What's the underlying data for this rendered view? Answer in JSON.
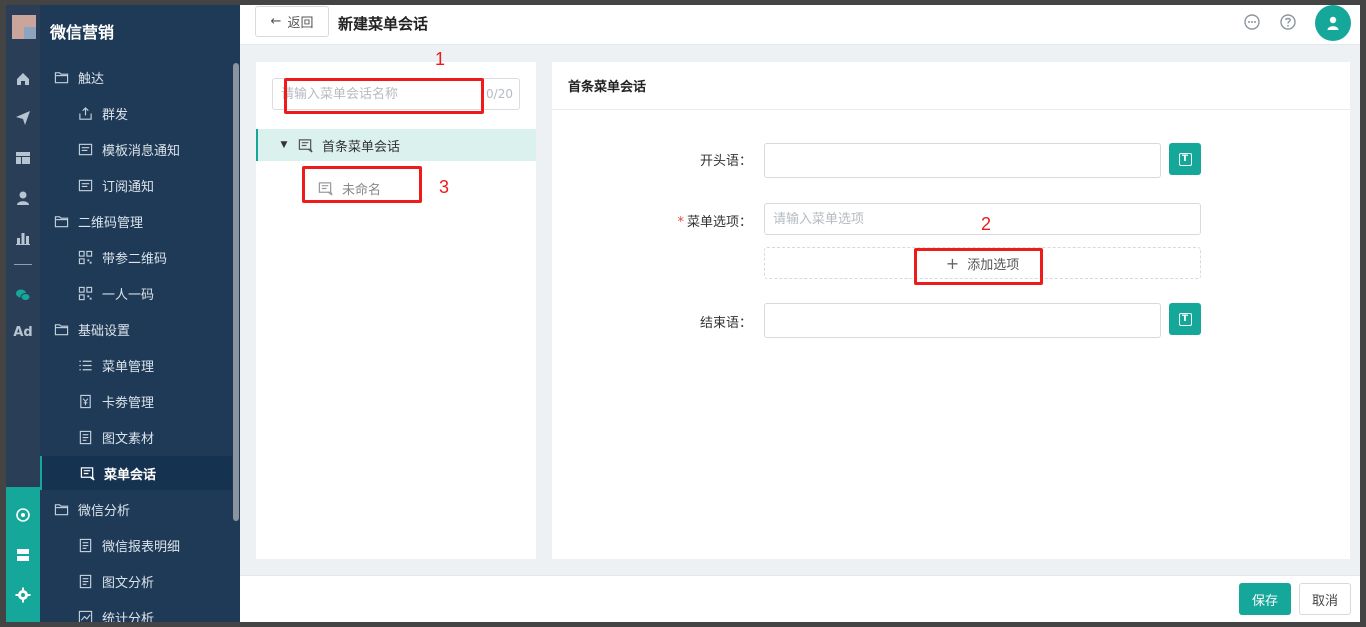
{
  "colors": {
    "accent": "#15a79a",
    "sidebar_bg": "#1f3a56",
    "annotation": "#ee1b1b"
  },
  "sidebar": {
    "title": "微信营销",
    "items": [
      {
        "label": "触达",
        "icon": "folder-icon",
        "level": 1
      },
      {
        "label": "群发",
        "icon": "share-icon",
        "level": 2
      },
      {
        "label": "模板消息通知",
        "icon": "message-card-icon",
        "level": 2
      },
      {
        "label": "订阅通知",
        "icon": "message-card-icon",
        "level": 2
      },
      {
        "label": "二维码管理",
        "icon": "folder-icon",
        "level": 1
      },
      {
        "label": "带参二维码",
        "icon": "qrcode-icon",
        "level": 2
      },
      {
        "label": "一人一码",
        "icon": "qrcode-icon",
        "level": 2
      },
      {
        "label": "基础设置",
        "icon": "folder-icon",
        "level": 1
      },
      {
        "label": "菜单管理",
        "icon": "list-icon",
        "level": 2
      },
      {
        "label": "卡劵管理",
        "icon": "coupon-icon",
        "level": 2
      },
      {
        "label": "图文素材",
        "icon": "document-icon",
        "level": 2
      },
      {
        "label": "菜单会话",
        "icon": "chat-icon",
        "level": 2,
        "active": true
      },
      {
        "label": "微信分析",
        "icon": "folder-icon",
        "level": 1
      },
      {
        "label": "微信报表明细",
        "icon": "document-icon",
        "level": 2
      },
      {
        "label": "图文分析",
        "icon": "document-icon",
        "level": 2
      },
      {
        "label": "统计分析",
        "icon": "chart-icon",
        "level": 2
      }
    ]
  },
  "rail": {
    "ad_label": "Ad"
  },
  "header": {
    "back_label": "返回",
    "title": "新建菜单会话"
  },
  "left_panel": {
    "search_placeholder": "请输入菜单会话名称",
    "search_count": "0/20",
    "tree": [
      {
        "label": "首条菜单会话",
        "selected": true
      },
      {
        "label": "未命名",
        "child": true
      }
    ]
  },
  "right_panel": {
    "title": "首条菜单会话",
    "opening_label": "开头语：",
    "menu_option_label": "菜单选项：",
    "menu_option_placeholder": "请输入菜单选项",
    "add_option_label": "添加选项",
    "closing_label": "结束语："
  },
  "footer": {
    "save_label": "保存",
    "cancel_label": "取消"
  },
  "annotations": [
    "1",
    "2",
    "3"
  ]
}
